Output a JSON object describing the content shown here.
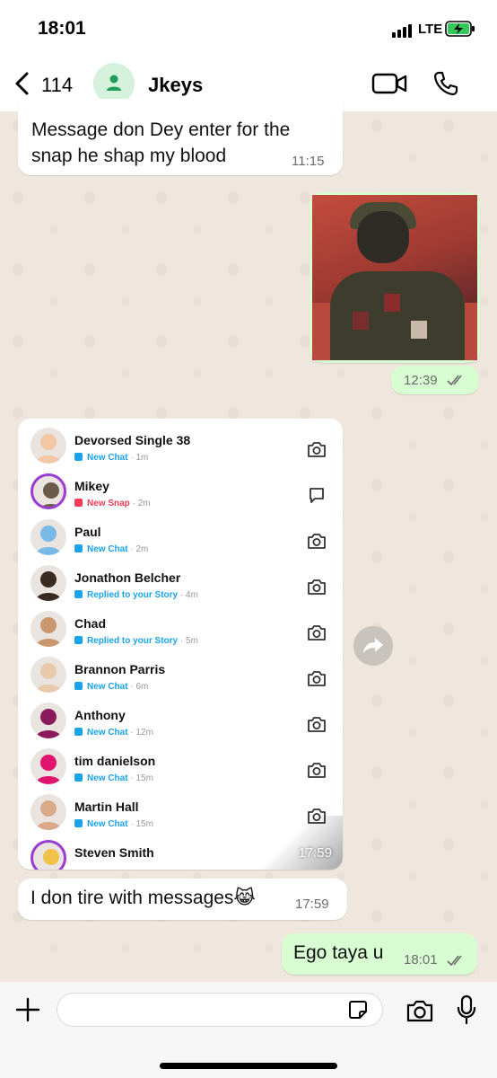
{
  "status_bar": {
    "time": "18:01",
    "network": "LTE"
  },
  "header": {
    "back_count": "114",
    "contact_name": "Jkeys"
  },
  "messages": [
    {
      "direction": "incoming",
      "text": "Message don Dey enter for the snap he shap my blood",
      "time": "11:15"
    },
    {
      "direction": "outgoing",
      "type": "image",
      "time": "12:39",
      "read": true
    },
    {
      "direction": "incoming",
      "type": "screenshot",
      "time": "17:59"
    },
    {
      "direction": "incoming",
      "text": "I don tire with messages😹",
      "time": "17:59"
    },
    {
      "direction": "outgoing",
      "text": "Ego taya u",
      "time": "18:01",
      "read": true
    }
  ],
  "snap_list": [
    {
      "name": "Devorsed Single 38",
      "status": "New Chat",
      "ago": "1m",
      "kind": "chat",
      "icon": "camera-icon"
    },
    {
      "name": "Mikey",
      "status": "New Snap",
      "ago": "2m",
      "kind": "snap",
      "icon": "chat-bubble-icon"
    },
    {
      "name": "Paul",
      "status": "New Chat",
      "ago": "2m",
      "kind": "chat",
      "icon": "camera-icon"
    },
    {
      "name": "Jonathon Belcher",
      "status": "Replied to your Story",
      "ago": "4m",
      "kind": "chat",
      "icon": "camera-icon"
    },
    {
      "name": "Chad",
      "status": "Replied to your Story",
      "ago": "5m",
      "kind": "chat",
      "icon": "camera-icon"
    },
    {
      "name": "Brannon Parris",
      "status": "New Chat",
      "ago": "6m",
      "kind": "chat",
      "icon": "camera-icon"
    },
    {
      "name": "Anthony",
      "status": "New Chat",
      "ago": "12m",
      "kind": "chat",
      "icon": "camera-icon"
    },
    {
      "name": "tim danielson",
      "status": "New Chat",
      "ago": "15m",
      "kind": "chat",
      "icon": "camera-icon"
    },
    {
      "name": "Martin Hall",
      "status": "New Chat",
      "ago": "15m",
      "kind": "chat",
      "icon": "camera-icon"
    },
    {
      "name": "Steven Smith",
      "status": "",
      "ago": "",
      "kind": "chat",
      "icon": ""
    }
  ],
  "colors": {
    "accent_green": "#25d366",
    "outgoing_bubble": "#d9fdd3",
    "snap_blue": "#1aa3e8",
    "snap_red": "#f23c57"
  }
}
